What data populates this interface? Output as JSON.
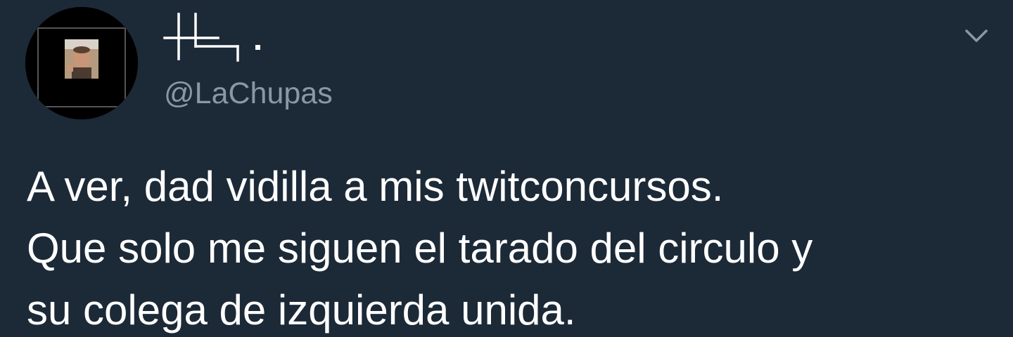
{
  "author": {
    "display_name_icon": "custom-glyph-name-logo",
    "handle": "@LaChupas",
    "avatar": "profile-photo-icon"
  },
  "menu": {
    "caret_icon": "chevron-down-icon"
  },
  "tweet": {
    "text": "A ver, dad vidilla a mis twitconcursos.\nQue solo me siguen el tarado del circulo y\nsu colega de izquierda unida."
  },
  "colors": {
    "background": "#1c2937",
    "text": "#ffffff",
    "secondary_text": "#8899a6"
  }
}
